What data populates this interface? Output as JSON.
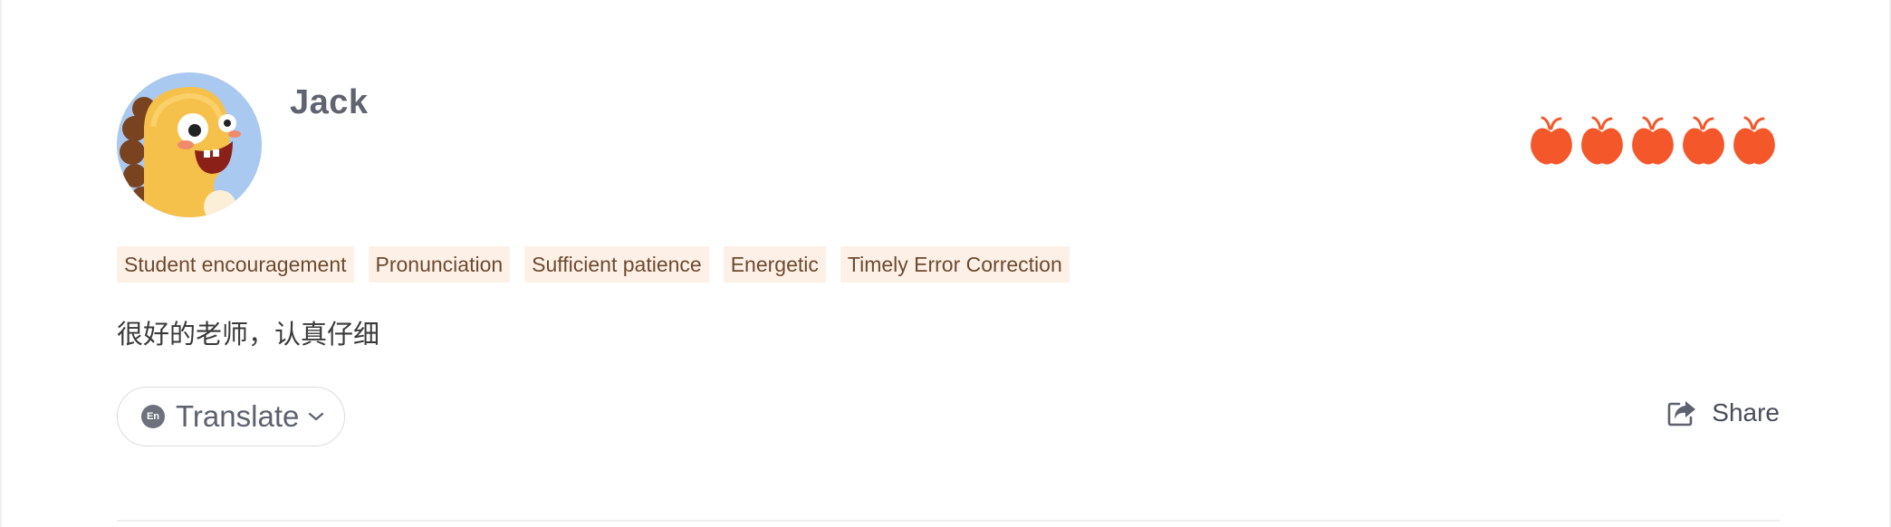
{
  "review": {
    "reviewer_name": "Jack",
    "avatar_icon": "dinosaur-avatar",
    "rating": 5,
    "rating_max": 5,
    "rating_icon": "apple-icon",
    "rating_color": "#f4572a",
    "tags": [
      "Student encouragement",
      "Pronunciation",
      "Sufficient patience",
      "Energetic",
      "Timely Error Correction"
    ],
    "comment": "很好的老师，认真仔细",
    "translate": {
      "language_badge": "En",
      "label": "Translate",
      "icon": "chevron-down-icon"
    },
    "share": {
      "label": "Share",
      "icon": "share-icon"
    }
  },
  "colors": {
    "tag_background": "#fdf1e7",
    "tag_text": "#6e4a2e",
    "name_text": "#5f6470",
    "avatar_background": "#a9c9f0"
  }
}
